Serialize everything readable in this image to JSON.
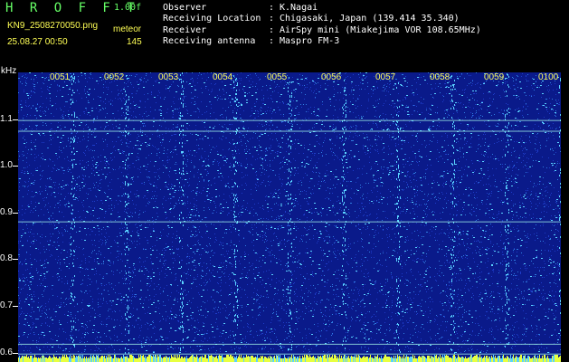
{
  "header": {
    "app_title": "H R O F F T",
    "version": "1.00f",
    "filename": "KN9_2508270050.png",
    "mode": "meteor",
    "datetime": "25.08.27 00:50",
    "count": "145"
  },
  "info": [
    {
      "label": "Observer",
      "colon": ":",
      "value": "K.Nagai"
    },
    {
      "label": "Receiving Location",
      "colon": ":",
      "value": "Chigasaki, Japan (139.414 35.340)"
    },
    {
      "label": "Receiver",
      "colon": ":",
      "value": "AirSpy mini (Miakejima VOR 108.65MHz)"
    },
    {
      "label": "Receiving antenna",
      "colon": ":",
      "value": "Maspro FM-3"
    }
  ],
  "chart_data": {
    "type": "heatmap",
    "ylabel": "kHz",
    "y_ticks": [
      "1.1",
      "1.0",
      "0.9",
      "0.8",
      "0.7",
      "0.6"
    ],
    "y_tick_values": [
      1.1,
      1.0,
      0.9,
      0.8,
      0.7,
      0.6
    ],
    "ylim": [
      0.58,
      1.2
    ],
    "x_ticks": [
      "0051",
      "0052",
      "0053",
      "0054",
      "0055",
      "0056",
      "0057",
      "0058",
      "0059",
      "0100"
    ],
    "x_tick_minutes": [
      1,
      2,
      3,
      4,
      5,
      6,
      7,
      8,
      9,
      10
    ],
    "xlim_minutes": [
      0,
      10
    ],
    "horizontal_lines_khz": [
      1.098,
      1.075,
      0.881,
      0.619,
      0.598
    ],
    "colors": {
      "background": "#0a1a8a",
      "noise_low": "#1e3cc8",
      "noise_high": "#5ad2ff",
      "signal": "#aaffee",
      "bottom_band": "#e8ff40"
    }
  }
}
